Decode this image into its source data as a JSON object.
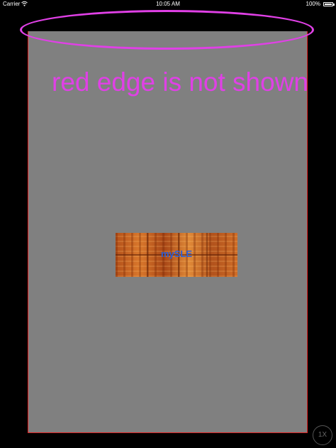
{
  "status_bar": {
    "carrier": "Carrier",
    "wifi_icon": "wifi-icon",
    "time": "10:05 AM",
    "battery_percent": "100%",
    "battery_icon": "battery-icon"
  },
  "annotation": {
    "text": "red edge is not shown",
    "color": "#e040e6"
  },
  "content": {
    "view_background": "#808080",
    "edge_color": "#dd2222",
    "image_label": "mySLE"
  },
  "scale_button": {
    "label": "1X"
  }
}
